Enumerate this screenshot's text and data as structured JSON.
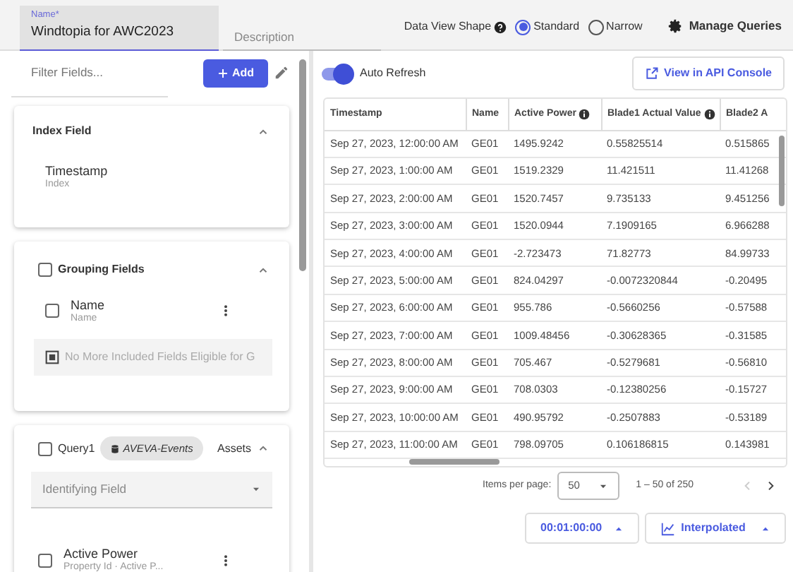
{
  "header": {
    "name_field": {
      "label": "Name*",
      "value": "Windtopia for AWC2023"
    },
    "description_field": {
      "placeholder": "Description"
    },
    "data_view_shape": {
      "label": "Data View Shape",
      "options": [
        {
          "label": "Standard",
          "selected": true
        },
        {
          "label": "Narrow",
          "selected": false
        }
      ]
    },
    "manage_queries": "Manage Queries"
  },
  "sidebar": {
    "filter": {
      "placeholder": "Filter Fields..."
    },
    "add_button": "Add",
    "index_card": {
      "title": "Index Field",
      "expanded": true,
      "field": {
        "name": "Timestamp",
        "sub": "Index"
      }
    },
    "grouping_card": {
      "title": "Grouping Fields",
      "checked": false,
      "expanded": true,
      "fields": [
        {
          "name": "Name",
          "sub": "Name",
          "checked": false
        }
      ],
      "empty_message": "No More Included Fields Eligible for G"
    },
    "query_card": {
      "title": "Query1",
      "checked": false,
      "source": "AVEVA-Events",
      "type": "Assets",
      "expanded": true,
      "identifying_field": {
        "placeholder": "Identifying Field"
      },
      "fields": [
        {
          "name": "Active Power",
          "sub": "Property Id · Active P...",
          "checked": false
        }
      ]
    }
  },
  "main": {
    "auto_refresh": {
      "label": "Auto Refresh",
      "on": true
    },
    "api_button": "View in API Console",
    "table": {
      "columns": [
        {
          "label": "Timestamp",
          "info": false
        },
        {
          "label": "Name",
          "info": false
        },
        {
          "label": "Active Power",
          "info": true
        },
        {
          "label": "Blade1 Actual Value",
          "info": true
        },
        {
          "label": "Blade2 A",
          "info": false
        }
      ],
      "rows": [
        [
          "Sep 27, 2023, 12:00:00 AM",
          "GE01",
          "1495.9242",
          "0.55825514",
          "0.515865"
        ],
        [
          "Sep 27, 2023, 1:00:00 AM",
          "GE01",
          "1519.2329",
          "11.421511",
          "11.41268"
        ],
        [
          "Sep 27, 2023, 2:00:00 AM",
          "GE01",
          "1520.7457",
          "9.735133",
          "9.451256"
        ],
        [
          "Sep 27, 2023, 3:00:00 AM",
          "GE01",
          "1520.0944",
          "7.1909165",
          "6.966288"
        ],
        [
          "Sep 27, 2023, 4:00:00 AM",
          "GE01",
          "-2.723473",
          "71.82773",
          "84.99733"
        ],
        [
          "Sep 27, 2023, 5:00:00 AM",
          "GE01",
          "824.04297",
          "-0.0072320844",
          "-0.20495"
        ],
        [
          "Sep 27, 2023, 6:00:00 AM",
          "GE01",
          "955.786",
          "-0.5660256",
          "-0.57588"
        ],
        [
          "Sep 27, 2023, 7:00:00 AM",
          "GE01",
          "1009.48456",
          "-0.30628365",
          "-0.31585"
        ],
        [
          "Sep 27, 2023, 8:00:00 AM",
          "GE01",
          "705.467",
          "-0.5279681",
          "-0.56810"
        ],
        [
          "Sep 27, 2023, 9:00:00 AM",
          "GE01",
          "708.0303",
          "-0.12380256",
          "-0.15727"
        ],
        [
          "Sep 27, 2023, 10:00:00 AM",
          "GE01",
          "490.95792",
          "-0.2507883",
          "-0.53189"
        ],
        [
          "Sep 27, 2023, 11:00:00 AM",
          "GE01",
          "798.09705",
          "0.106186815",
          "0.143981"
        ]
      ]
    },
    "pagination": {
      "label": "Items per page:",
      "per_page": "50",
      "range": "1 – 50 of 250"
    },
    "interval_button": "00:01:00:00",
    "interpolation_button": "Interpolated"
  }
}
